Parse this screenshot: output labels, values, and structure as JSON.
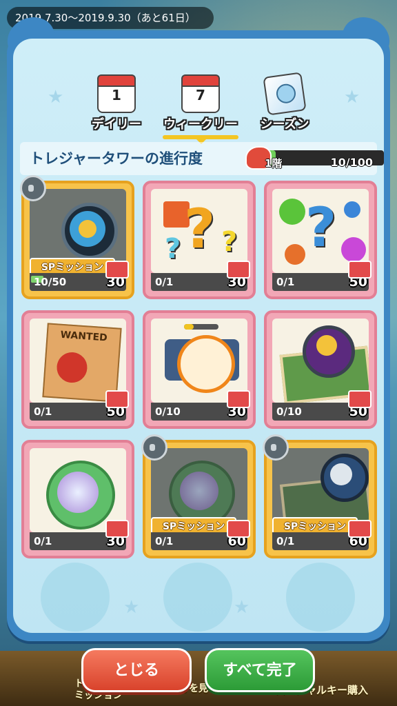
{
  "period": "2019.7.30～2019.9.30（あと61日）",
  "tabs": [
    {
      "label": "デイリー",
      "icon": "calendar-1-icon",
      "num": "1"
    },
    {
      "label": "ウィークリー",
      "icon": "calendar-7-icon",
      "num": "7",
      "active": true
    },
    {
      "label": "シーズン",
      "icon": "season-ticket-icon"
    }
  ],
  "progress": {
    "title": "トレジャータワーの進行度",
    "floor": "1階",
    "count": "10/100",
    "value": 0.1
  },
  "missions": [
    {
      "progress": "10/50",
      "reward": "30",
      "sp": true,
      "locked": true,
      "sp_label": "SPミッション",
      "art": "sun-map-icon",
      "fill": 0.2
    },
    {
      "progress": "0/1",
      "reward": "30",
      "art": "fist-question-icon"
    },
    {
      "progress": "0/1",
      "reward": "50",
      "art": "elements-question-icon"
    },
    {
      "progress": "0/1",
      "reward": "50",
      "art": "wanted-poster-icon",
      "poster": "WANTED"
    },
    {
      "progress": "0/10",
      "reward": "30",
      "art": "target-yokai-icon"
    },
    {
      "progress": "0/10",
      "reward": "50",
      "art": "moon-map-icon"
    },
    {
      "progress": "0/1",
      "reward": "30",
      "art": "spiral-medal-icon"
    },
    {
      "progress": "0/1",
      "reward": "60",
      "sp": true,
      "locked": true,
      "sp_label": "SPミッション",
      "art": "spiral-medal-icon"
    },
    {
      "progress": "0/1",
      "reward": "60",
      "sp": true,
      "locked": true,
      "sp_label": "SPミッション",
      "art": "clock-map-icon"
    }
  ],
  "buttons": {
    "close": "とじる",
    "complete": "すべて完了"
  },
  "background": {
    "left": "トレジャー\nミッション",
    "middle": "マンガを見る",
    "right": "スペシャルキー購入"
  }
}
